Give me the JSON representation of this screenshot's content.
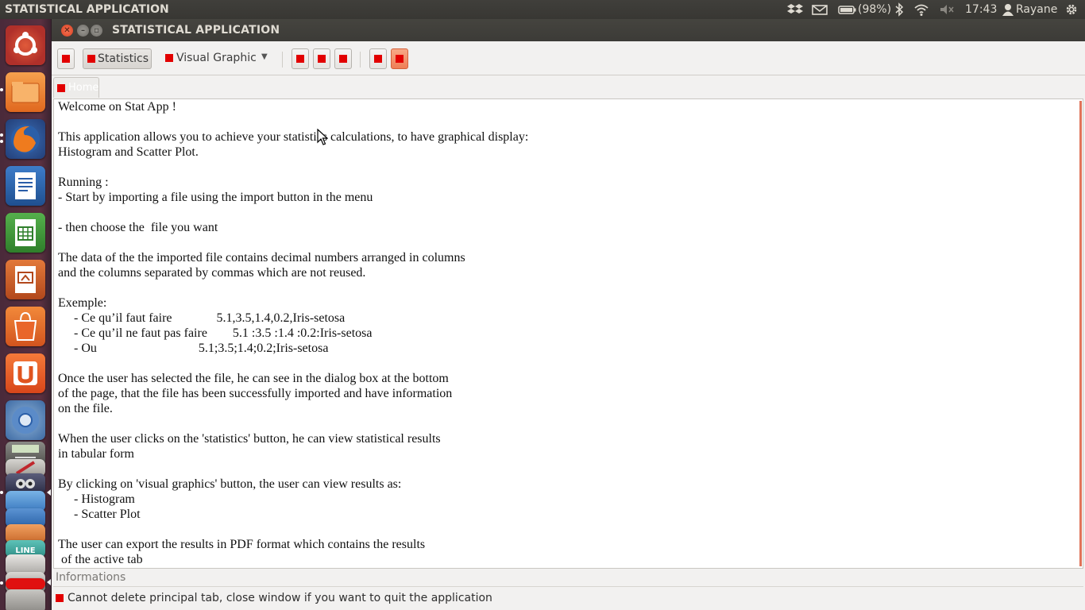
{
  "top_panel": {
    "app_name": "STATISTICAL APPLICATION",
    "battery": "(98%)",
    "time": "17:43",
    "user": "Rayane",
    "icons": [
      "dropbox-icon",
      "mail-icon",
      "battery-icon",
      "bluetooth-icon",
      "wifi-icon",
      "volume-icon",
      "user-icon",
      "settings-gear-icon"
    ]
  },
  "launcher": {
    "items": [
      "ubuntu-dash",
      "files",
      "firefox",
      "libreoffice-writer",
      "libreoffice-calc",
      "libreoffice-impress",
      "software-center",
      "ubuntu-one",
      "chromium",
      "calculator",
      "system-settings",
      "gimp",
      "screenshot",
      "image-viewer",
      "archive-manager",
      "scanner",
      "trash"
    ]
  },
  "window": {
    "title": "STATISTICAL APPLICATION"
  },
  "toolbar": {
    "statistics_label": "Statistics",
    "visual_graphic_label": "Visual Graphic"
  },
  "tabs": [
    {
      "label": "Home"
    }
  ],
  "content": {
    "text": "Welcome on Stat App !\n\nThis application allows you to achieve your statistics calculations, to have graphical display:\nHistogram and Scatter Plot.\n\nRunning :\n- Start by importing a file using the import button in the menu\n\n- then choose the  file you want\n\nThe data of the the imported file contains decimal numbers arranged in columns\nand the columns separated by commas which are not reused.\n\nExemple:\n     - Ce qu’il faut faire              5.1,3.5,1.4,0.2,Iris-setosa\n     - Ce qu’il ne faut pas faire        5.1 :3.5 :1.4 :0.2:Iris-setosa\n     - Ou                                5.1;3.5;1.4;0.2;Iris-setosa\n\nOnce the user has selected the file, he can see in the dialog box at the bottom\nof the page, that the file has been successfully imported and have information\non the file.\n\nWhen the user clicks on the 'statistics' button, he can view statistical results\nin tabular form\n\nBy clicking on 'visual graphics' button, the user can view results as:\n     - Histogram\n     - Scatter Plot\n\nThe user can export the results in PDF format which contains the results\n of the active tab"
  },
  "info": {
    "label": "Informations",
    "message": "Cannot delete principal tab, close window if you want to quit the application"
  }
}
